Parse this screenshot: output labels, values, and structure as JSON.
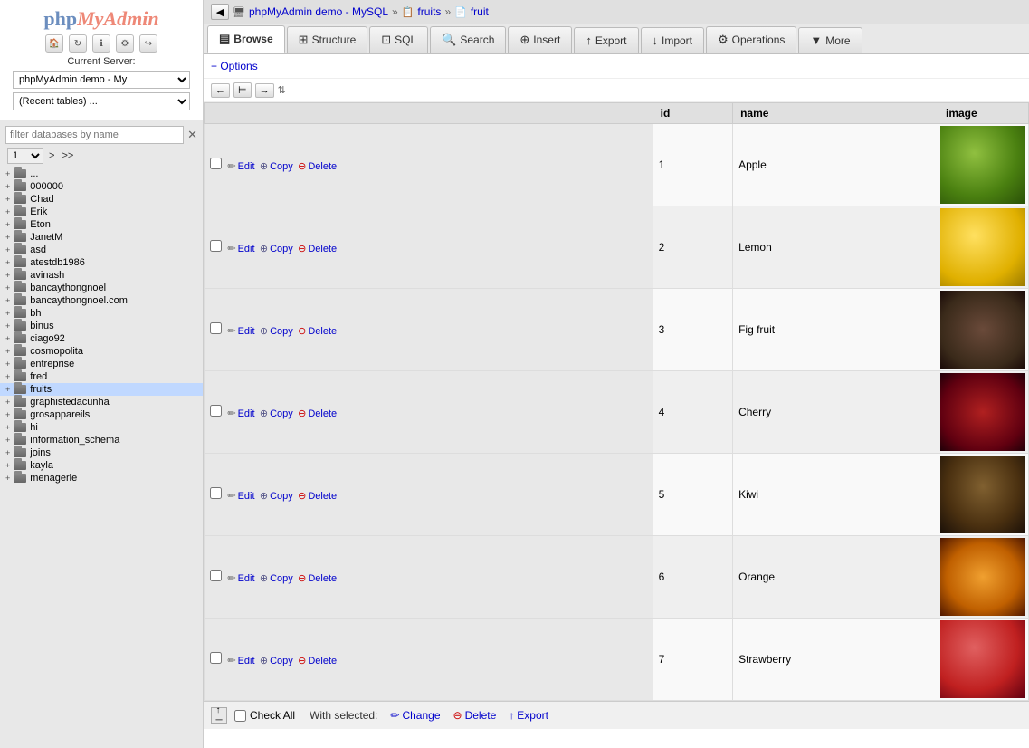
{
  "sidebar": {
    "logo_php": "php",
    "logo_myadmin": "MyAdmin",
    "current_server_label": "Current Server:",
    "server_value": "phpMyAdmin demo - My",
    "recent_tables": "(Recent tables) ...",
    "filter_placeholder": "filter databases by name",
    "page_number": "1",
    "nav_gt": ">",
    "nav_gtgt": ">>",
    "db_items": [
      {
        "name": "..."
      },
      {
        "name": "000000"
      },
      {
        "name": "Chad"
      },
      {
        "name": "Erik"
      },
      {
        "name": "Eton"
      },
      {
        "name": "JanetM"
      },
      {
        "name": "asd"
      },
      {
        "name": "atestdb1986"
      },
      {
        "name": "avinash"
      },
      {
        "name": "bancaythongnoel"
      },
      {
        "name": "bancaythongnoel.com"
      },
      {
        "name": "bh"
      },
      {
        "name": "binus"
      },
      {
        "name": "ciago92"
      },
      {
        "name": "cosmopolita"
      },
      {
        "name": "entreprise"
      },
      {
        "name": "fred"
      },
      {
        "name": "fruits",
        "active": true
      },
      {
        "name": "graphistedacunha"
      },
      {
        "name": "grosappareils"
      },
      {
        "name": "hi"
      },
      {
        "name": "information_schema"
      },
      {
        "name": "joins"
      },
      {
        "name": "kayla"
      },
      {
        "name": "menagerie"
      }
    ]
  },
  "breadcrumb": {
    "app": "phpMyAdmin demo - MySQL",
    "db": "fruits",
    "table": "fruit"
  },
  "tabs": [
    {
      "id": "browse",
      "label": "Browse",
      "icon": "▤",
      "active": true
    },
    {
      "id": "structure",
      "label": "Structure",
      "icon": "⊞"
    },
    {
      "id": "sql",
      "label": "SQL",
      "icon": "⊡"
    },
    {
      "id": "search",
      "label": "Search",
      "icon": "🔍"
    },
    {
      "id": "insert",
      "label": "Insert",
      "icon": "⊕"
    },
    {
      "id": "export",
      "label": "Export",
      "icon": "↑"
    },
    {
      "id": "import",
      "label": "Import",
      "icon": "↓"
    },
    {
      "id": "operations",
      "label": "Operations",
      "icon": "⚙"
    },
    {
      "id": "more",
      "label": "More",
      "icon": "▼"
    }
  ],
  "options_link": "+ Options",
  "nav": {
    "prev_icon": "←",
    "first_icon": "⊨",
    "next_icon": "→"
  },
  "table": {
    "columns": [
      "",
      "id",
      "name",
      "image"
    ],
    "rows": [
      {
        "id": 1,
        "name": "Apple",
        "fruit_class": "fruit-apple"
      },
      {
        "id": 2,
        "name": "Lemon",
        "fruit_class": "fruit-lemon"
      },
      {
        "id": 3,
        "name": "Fig fruit",
        "fruit_class": "fruit-fig"
      },
      {
        "id": 4,
        "name": "Cherry",
        "fruit_class": "fruit-cherry"
      },
      {
        "id": 5,
        "name": "Kiwi",
        "fruit_class": "fruit-kiwi"
      },
      {
        "id": 6,
        "name": "Orange",
        "fruit_class": "fruit-orange"
      },
      {
        "id": 7,
        "name": "Strawberry",
        "fruit_class": "fruit-strawberry"
      }
    ],
    "action_edit": "Edit",
    "action_copy": "Copy",
    "action_delete": "Delete"
  },
  "bottom": {
    "check_all": "Check All",
    "with_selected": "With selected:",
    "change": "Change",
    "delete": "Delete",
    "export": "Export"
  }
}
